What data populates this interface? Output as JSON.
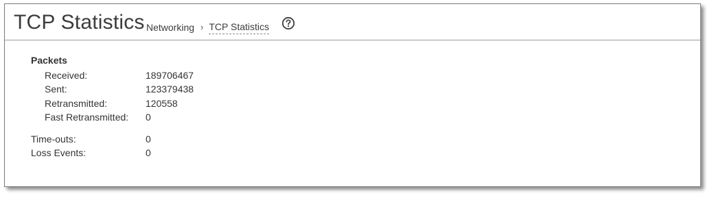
{
  "header": {
    "title": "TCP Statistics",
    "breadcrumb": {
      "parent": "Networking",
      "separator": "›",
      "current": "TCP Statistics"
    },
    "help_icon": "help-circle-icon"
  },
  "packets": {
    "title": "Packets",
    "rows": [
      {
        "label": "Received:",
        "value": "189706467"
      },
      {
        "label": "Sent:",
        "value": "123379438"
      },
      {
        "label": "Retransmitted:",
        "value": "120558"
      },
      {
        "label": "Fast Retransmitted:",
        "value": "0"
      }
    ]
  },
  "other": {
    "rows": [
      {
        "label": "Time-outs:",
        "value": "0"
      },
      {
        "label": "Loss Events:",
        "value": "0"
      }
    ]
  },
  "colors": {
    "text": "#333333",
    "border": "#9a9a9a"
  }
}
